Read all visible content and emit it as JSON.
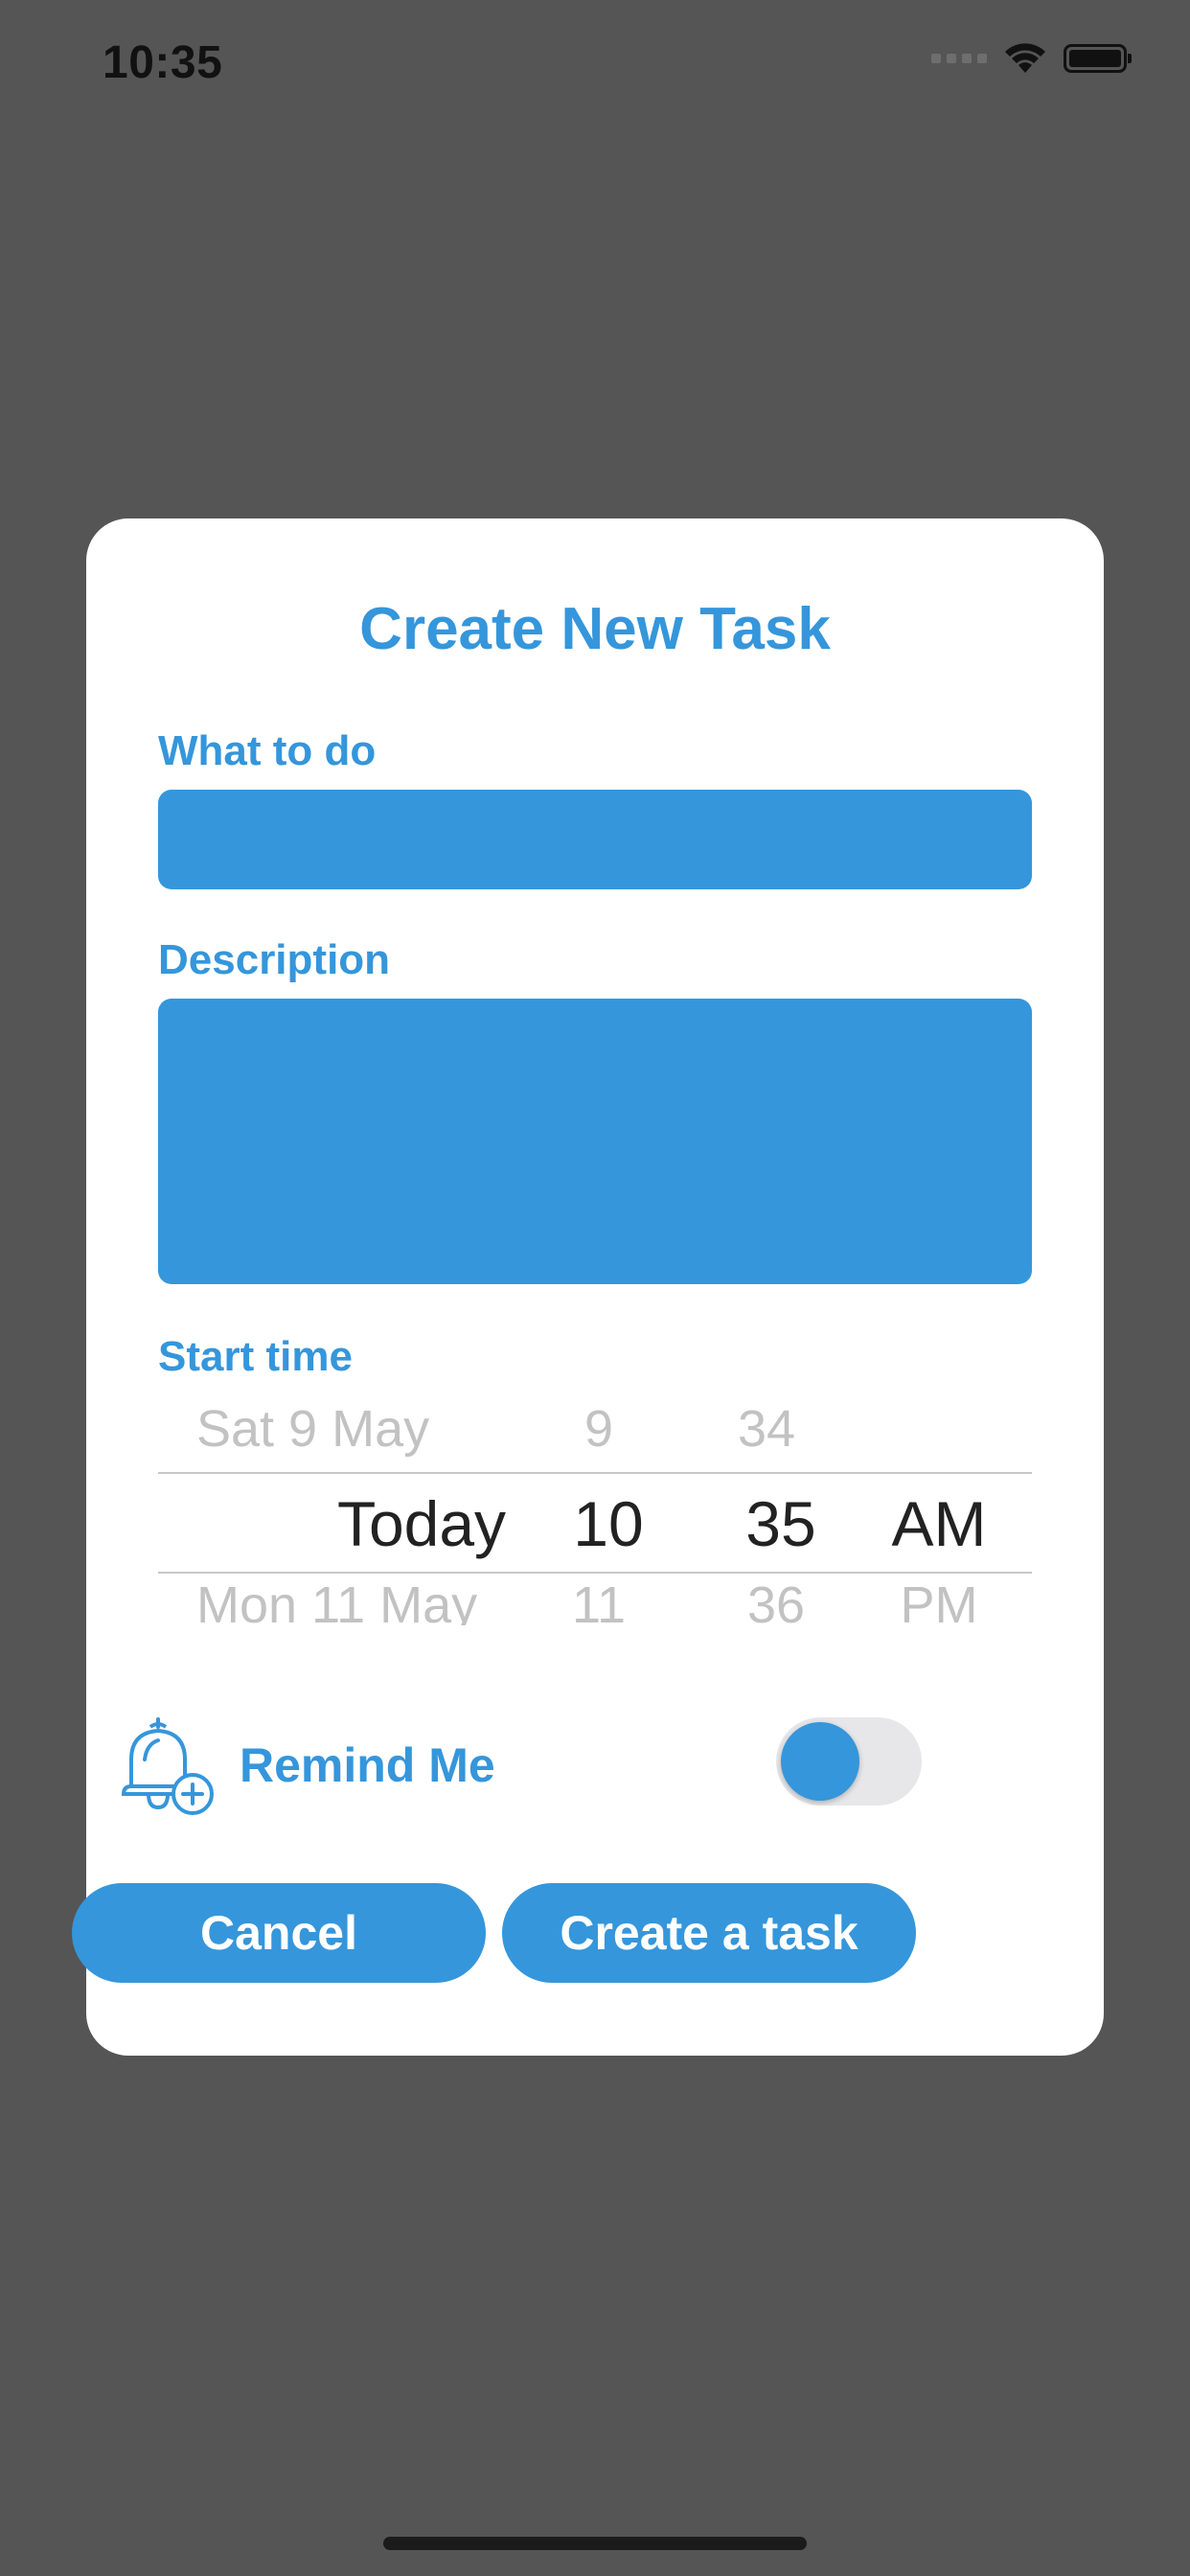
{
  "status_bar": {
    "time": "10:35",
    "wifi_icon": "wifi-icon",
    "battery_icon": "battery-icon"
  },
  "modal": {
    "title": "Create New Task",
    "what_label": "What to do",
    "what_value": "",
    "description_label": "Description",
    "description_value": "",
    "start_time_label": "Start time",
    "picker": {
      "above": {
        "day": "Sat 9 May",
        "hour": "9",
        "minute": "34",
        "period": ""
      },
      "selected": {
        "day": "Today",
        "hour": "10",
        "minute": "35",
        "period": "AM"
      },
      "below": {
        "day": "Mon 11 May",
        "hour": "11",
        "minute": "36",
        "period": "PM"
      }
    },
    "remind_label": "Remind Me",
    "remind_enabled": true,
    "cancel_label": "Cancel",
    "create_label": "Create a task"
  },
  "colors": {
    "accent": "#3596db",
    "overlay": "#555555",
    "card": "#ffffff"
  }
}
